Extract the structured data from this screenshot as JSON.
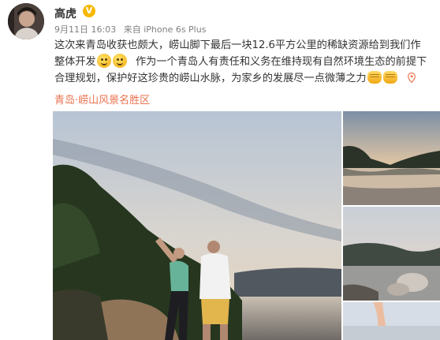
{
  "post": {
    "author": "高虎",
    "verified_badge": "V",
    "date": "9月11日 16:03",
    "source": "来自 iPhone 6s Plus",
    "text_lines": [
      "这次来青岛收获也颇大，崂山脚下最后一块12.6平方公里的稀缺资源给到我们作",
      "整体开发",
      "作为一个青岛人有责任和义务在维持现有自然环境生态的前提下",
      "合理规划，保护好这珍贵的崂山水脉，为家乡的发展尽一点微薄之力"
    ],
    "location": "青岛·崂山风景名胜区"
  },
  "icons": {
    "smile_emoji": "smile-emoji-icon",
    "fist_emoji": "fist-emoji-icon",
    "location": "location-pin-icon",
    "verified": "verified-v-icon"
  },
  "colors": {
    "location_text": "#eb7350",
    "meta_text": "#808080",
    "verified_badge": "#f7b801"
  }
}
